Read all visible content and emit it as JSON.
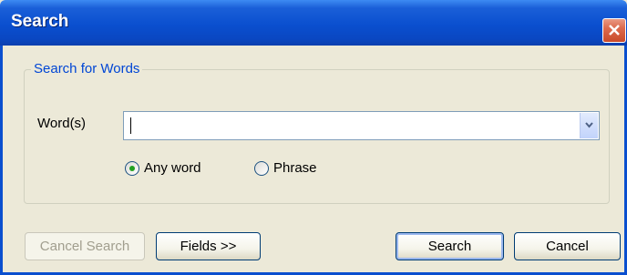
{
  "window": {
    "title": "Search",
    "close_icon": "close-icon"
  },
  "group": {
    "legend": "Search for Words",
    "words_label": "Word(s)",
    "words_value": "",
    "dropdown_icon": "chevron-down-icon",
    "options": [
      {
        "label": "Any word",
        "selected": true
      },
      {
        "label": "Phrase",
        "selected": false
      }
    ]
  },
  "buttons": {
    "cancel_search": "Cancel Search",
    "fields": "Fields >>",
    "search": "Search",
    "cancel": "Cancel"
  },
  "colors": {
    "titlebar": "#0A4FCF",
    "group_legend": "#0046D5",
    "radio_dot": "#21A121",
    "dialog_bg": "#ECE9D8"
  }
}
